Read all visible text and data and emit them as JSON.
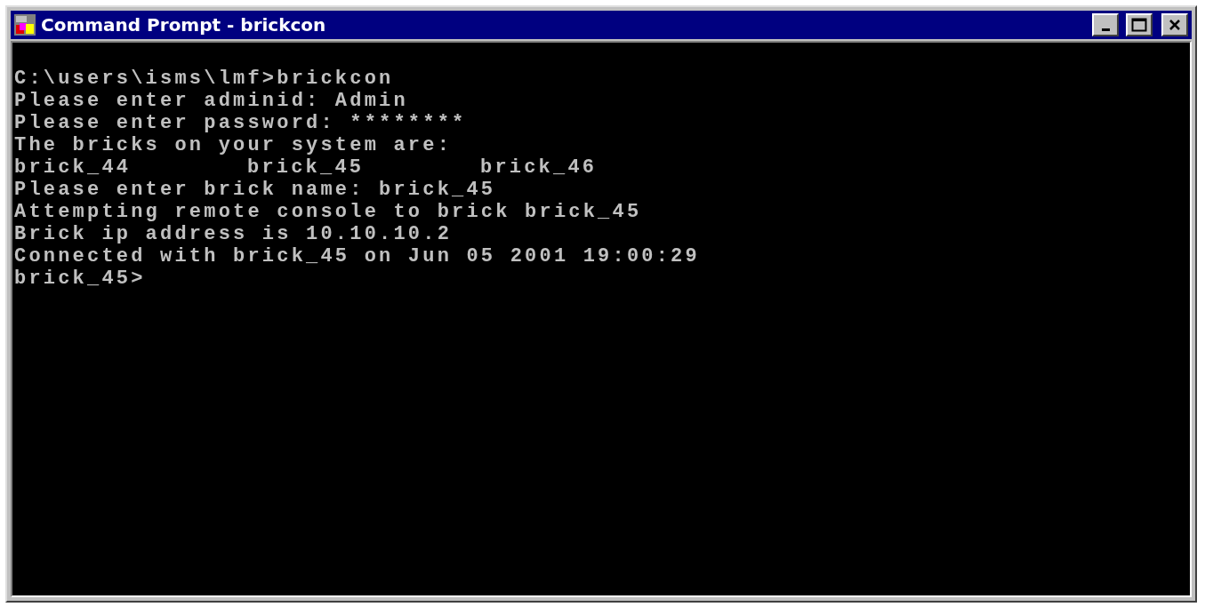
{
  "window": {
    "title": "Command Prompt - brickcon"
  },
  "console": {
    "lines": [
      {
        "kind": "text",
        "text": "C:\\users\\isms\\lmf>brickcon"
      },
      {
        "kind": "text",
        "text": "Please enter adminid: Admin"
      },
      {
        "kind": "text",
        "text": "Please enter password: ********"
      },
      {
        "kind": "text",
        "text": "The bricks on your system are:"
      },
      {
        "kind": "columns",
        "cells": [
          "brick_44",
          "brick_45",
          "brick_46"
        ]
      },
      {
        "kind": "text",
        "text": "Please enter brick name: brick_45"
      },
      {
        "kind": "text",
        "text": "Attempting remote console to brick brick_45"
      },
      {
        "kind": "text",
        "text": "Brick ip address is 10.10.10.2"
      },
      {
        "kind": "text",
        "text": "Connected with brick_45 on Jun 05 2001 19:00:29"
      },
      {
        "kind": "text",
        "text": "brick_45>"
      }
    ]
  }
}
